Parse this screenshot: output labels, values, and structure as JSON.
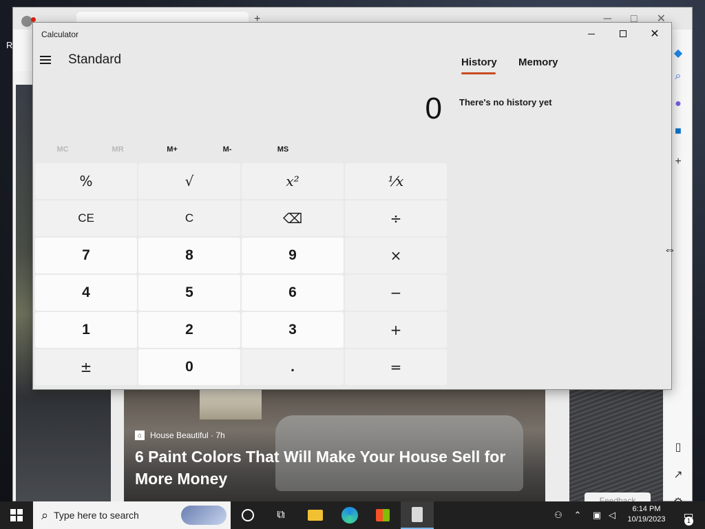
{
  "desktop": {
    "label": "R"
  },
  "browser": {
    "tab_title": "",
    "new_tab": "+",
    "article": {
      "source": "House Beautiful · 7h",
      "headline": "6 Paint Colors That Will Make Your House Sell for More Money"
    },
    "feedback": "Feedback"
  },
  "calculator": {
    "window_title": "Calculator",
    "mode": "Standard",
    "display": "0",
    "memory_buttons": [
      "MC",
      "MR",
      "M+",
      "M-",
      "MS"
    ],
    "keys": [
      [
        "%",
        "√",
        "x²",
        "¹⁄x"
      ],
      [
        "CE",
        "C",
        "⌫",
        "÷"
      ],
      [
        "7",
        "8",
        "9",
        "×"
      ],
      [
        "4",
        "5",
        "6",
        "−"
      ],
      [
        "1",
        "2",
        "3",
        "+"
      ],
      [
        "±",
        "0",
        ".",
        "="
      ]
    ],
    "tabs": {
      "history": "History",
      "memory": "Memory"
    },
    "history_empty": "There's no history yet",
    "accent_color": "#c84b21"
  },
  "taskbar": {
    "search_placeholder": "Type here to search",
    "time": "6:14 PM",
    "date": "10/19/2023",
    "notification_count": "1"
  }
}
